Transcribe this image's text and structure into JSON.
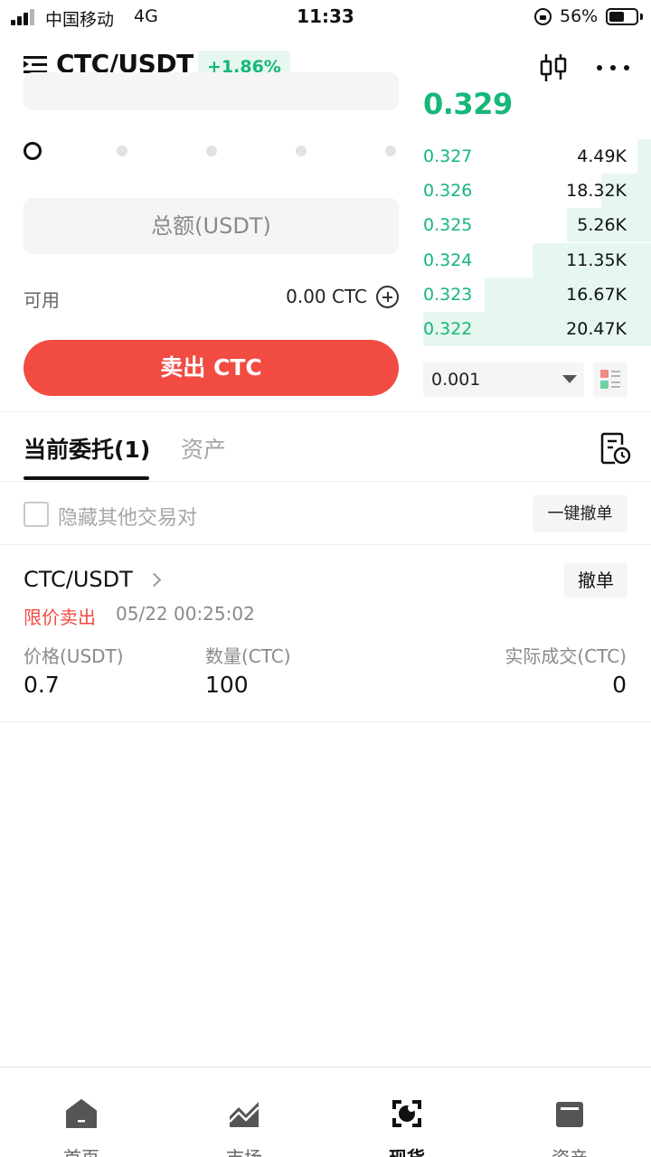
{
  "status_bar": {
    "carrier": "中国移动",
    "network": "4G",
    "time": "11:33",
    "battery_percent": "56%",
    "battery_level": 0.56
  },
  "header": {
    "pair": "CTC/USDT",
    "change": "+1.86%",
    "icons": [
      "menu-icon",
      "kline-chart-icon",
      "more-icon"
    ]
  },
  "order_form": {
    "slider_level": 0,
    "total_placeholder": "总额(USDT)",
    "available_label": "可用",
    "available_value": "0.00 CTC",
    "sell_button": "卖出 CTC"
  },
  "order_book": {
    "last_price": "0.329",
    "rows": [
      {
        "price": "0.327",
        "qty": "4.49K",
        "depth": 0.06
      },
      {
        "price": "0.326",
        "qty": "18.32K",
        "depth": 0.22
      },
      {
        "price": "0.325",
        "qty": "5.26K",
        "depth": 0.37
      },
      {
        "price": "0.324",
        "qty": "11.35K",
        "depth": 0.52
      },
      {
        "price": "0.323",
        "qty": "16.67K",
        "depth": 0.73
      },
      {
        "price": "0.322",
        "qty": "20.47K",
        "depth": 1.0
      }
    ],
    "precision": "0.001",
    "colors": {
      "bid": "#16b779",
      "depth": "#e6f7f0"
    }
  },
  "tabs": {
    "orders": "当前委托(1)",
    "assets": "资产"
  },
  "filters": {
    "hide_other_pairs": "隐藏其他交易对",
    "cancel_all": "一键撤单"
  },
  "order": {
    "pair": "CTC/USDT",
    "cancel": "撤单",
    "type": "限价卖出",
    "time": "05/22 00:25:02",
    "price_label": "价格(USDT)",
    "price": "0.7",
    "amount_label": "数量(CTC)",
    "amount": "100",
    "filled_label": "实际成交(CTC)",
    "filled": "0"
  },
  "bottom_nav": {
    "items": [
      {
        "label": "首页",
        "icon": "home-icon"
      },
      {
        "label": "市场",
        "icon": "market-chart-icon"
      },
      {
        "label": "现货",
        "icon": "spot-icon"
      },
      {
        "label": "资产",
        "icon": "wallet-icon"
      }
    ],
    "active": "现货"
  },
  "accent_sell": "#f14b42"
}
